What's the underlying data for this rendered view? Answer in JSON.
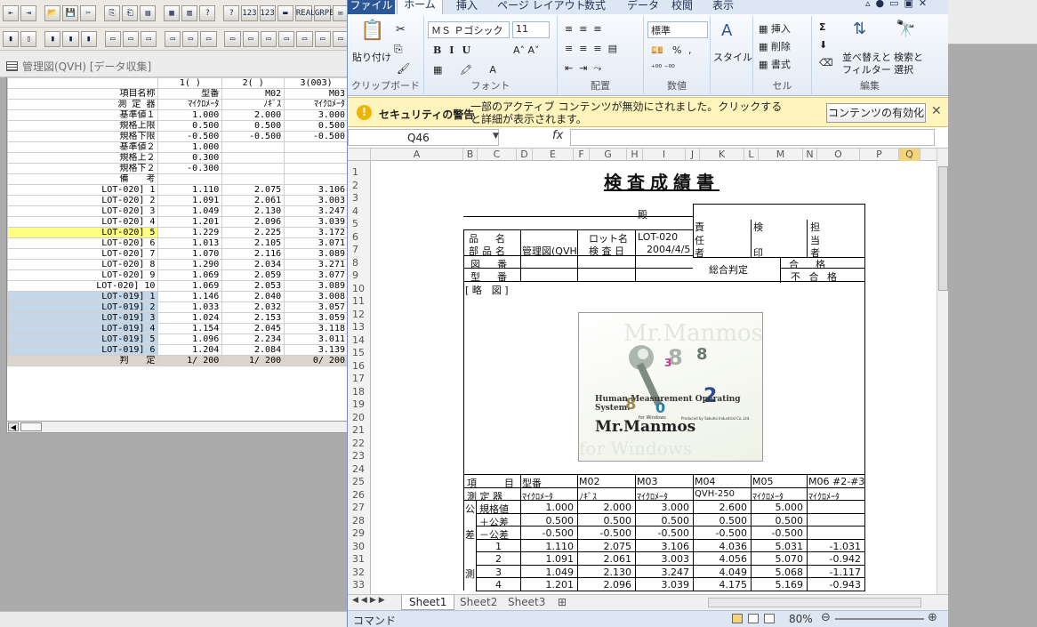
{
  "left_app": {
    "toolbar1": [
      "⇤",
      "⇥",
      "📂",
      "💾",
      "✂",
      "⎘",
      "⎗",
      "▤",
      "▦",
      "▥",
      "?",
      "?",
      "123",
      "123",
      "▬",
      "REAL",
      "GRPE",
      "✉"
    ],
    "toolbar2": [
      "▮",
      "▯",
      "▮",
      "▮",
      "▮",
      "▭",
      "▭",
      "▭",
      "▭",
      "▭",
      "▭",
      "▭",
      "▭",
      "▭",
      "▭",
      "▭",
      "▭",
      "▭"
    ],
    "window_title": "管理図(QVH) [データ収集]",
    "columns": [
      "1(   )",
      "2(   )",
      "3(003)"
    ],
    "rows": [
      {
        "label": "項目名称",
        "v": [
          "型番",
          "M02",
          "M03"
        ]
      },
      {
        "label": "測 定 器",
        "v": [
          "ﾏｲｸﾛﾒｰﾀ",
          "ﾉｷﾞｽ",
          "ﾏｲｸﾛﾒｰﾀ"
        ]
      },
      {
        "label": "基準値１",
        "v": [
          "1.000",
          "2.000",
          "3.000"
        ]
      },
      {
        "label": "規格上限",
        "v": [
          "0.500",
          "0.500",
          "0.500"
        ]
      },
      {
        "label": "規格下限",
        "v": [
          "-0.500",
          "-0.500",
          "-0.500"
        ]
      },
      {
        "label": "基準値２",
        "v": [
          "1.000",
          "",
          ""
        ]
      },
      {
        "label": "規格上２",
        "v": [
          "0.300",
          "",
          ""
        ]
      },
      {
        "label": "規格下２",
        "v": [
          "-0.300",
          "",
          ""
        ]
      },
      {
        "label": "備　　考",
        "v": [
          "",
          "",
          ""
        ]
      }
    ],
    "data_rows": [
      {
        "label": "LOT-020]     1",
        "v": [
          "1.110",
          "2.075",
          "3.106"
        ],
        "cls": "lot20"
      },
      {
        "label": "LOT-020]     2",
        "v": [
          "1.091",
          "2.061",
          "3.003"
        ],
        "cls": "lot20"
      },
      {
        "label": "LOT-020]     3",
        "v": [
          "1.049",
          "2.130",
          "3.247"
        ],
        "cls": "lot20"
      },
      {
        "label": "LOT-020]     4",
        "v": [
          "1.201",
          "2.096",
          "3.039"
        ],
        "cls": "lot20"
      },
      {
        "label": "LOT-020]     5",
        "v": [
          "1.229",
          "2.225",
          "3.172"
        ],
        "cls": "lot20 hl"
      },
      {
        "label": "LOT-020]     6",
        "v": [
          "1.013",
          "2.105",
          "3.071"
        ],
        "cls": "lot20"
      },
      {
        "label": "LOT-020]     7",
        "v": [
          "1.070",
          "2.116",
          "3.089"
        ],
        "cls": "lot20"
      },
      {
        "label": "LOT-020]     8",
        "v": [
          "1.290",
          "2.034",
          "3.271"
        ],
        "cls": "lot20"
      },
      {
        "label": "LOT-020]     9",
        "v": [
          "1.069",
          "2.059",
          "3.077"
        ],
        "cls": "lot20"
      },
      {
        "label": "LOT-020]    10",
        "v": [
          "1.069",
          "2.053",
          "3.089"
        ],
        "cls": "lot20"
      },
      {
        "label": "LOT-019]     1",
        "v": [
          "1.146",
          "2.040",
          "3.008"
        ],
        "cls": "lot19"
      },
      {
        "label": "LOT-019]     2",
        "v": [
          "1.033",
          "2.032",
          "3.057"
        ],
        "cls": "lot19"
      },
      {
        "label": "LOT-019]     3",
        "v": [
          "1.024",
          "2.153",
          "3.059"
        ],
        "cls": "lot19"
      },
      {
        "label": "LOT-019]     4",
        "v": [
          "1.154",
          "2.045",
          "3.118"
        ],
        "cls": "lot19"
      },
      {
        "label": "LOT-019]     5",
        "v": [
          "1.096",
          "2.234",
          "3.011"
        ],
        "cls": "lot19"
      },
      {
        "label": "LOT-019]     6",
        "v": [
          "1.204",
          "2.084",
          "3.139"
        ],
        "cls": "lot19"
      }
    ],
    "judge_row": {
      "label": "判　　定",
      "v": [
        "1/ 200",
        "1/ 200",
        "0/ 200"
      ]
    }
  },
  "excel": {
    "tabs": {
      "file": "ファイル",
      "home": "ホーム",
      "insert": "挿入",
      "layout": "ページ レイアウト",
      "formula": "数式",
      "data": "データ",
      "review": "校閲",
      "view": "表示"
    },
    "ribbon": {
      "paste": "貼り付け",
      "clipboard": "クリップボード",
      "font_name": "ＭＳ Ｐゴシック",
      "font_size": "11",
      "font": "フォント",
      "alignment": "配置",
      "number_format": "標準",
      "number": "数値",
      "style": "スタイル",
      "insert": "挿入",
      "delete": "削除",
      "format": "書式",
      "cells": "セル",
      "sort": "並べ替えと",
      "filter": "フィルター",
      "find": "検索と",
      "select": "選択",
      "edit": "編集",
      "percent": "%",
      "comma": ","
    },
    "security": {
      "title": "セキュリティの警告",
      "message": "一部のアクティブ コンテンツが無効にされました。クリックすると詳細が表示されます。",
      "button": "コンテンツの有効化"
    },
    "name_box": "Q46",
    "fx": "fx",
    "columns": [
      "A",
      "B",
      "C",
      "D",
      "E",
      "F",
      "G",
      "H",
      "I",
      "J",
      "K",
      "L",
      "M",
      "N",
      "O",
      "P",
      "Q"
    ],
    "rows": [
      "1",
      "2",
      "3",
      "4",
      "5",
      "6",
      "7",
      "8",
      "9",
      "10",
      "11",
      "12",
      "13",
      "14",
      "15",
      "16",
      "17",
      "18",
      "19",
      "20",
      "21",
      "22",
      "23",
      "24",
      "25",
      "26",
      "27",
      "28",
      "29",
      "30",
      "31",
      "32",
      "33"
    ],
    "doc": {
      "title": "検査成績書",
      "dono": "殿",
      "seki": "責",
      "nin": "任",
      "sha": "者",
      "ken": "検",
      "in": "印",
      "tan": "担",
      "tou": "当",
      "sha2": "者",
      "hinmei_l": "品　名",
      "buhin_l": "部品名",
      "buhin_v": "管理図(QVH",
      "lot_l": "ロット名",
      "lot_v": "LOT-020",
      "date_l": "検 査 日",
      "date_v": "2004/4/5",
      "zuban_l": "図　番",
      "kataban_l": "型　番",
      "sogo": "総合判定",
      "gokaku": "合　格",
      "fugokaku": "不 合 格",
      "ryakuzu": "[ 略　図 ]",
      "logo_watermark": "Mr.Manmos",
      "logo_tagline": "Human Measurement Operating System.",
      "logo_name": "Mr.Manmos",
      "logo_for": "for Windows",
      "logo_pub": "Produced by Sokuho Industrial Co.,Ltd.",
      "logo_wm2": "for Windows",
      "t_koumoku": "項　　目",
      "t_sokuteiki": "測 定 器",
      "t_kou": "公",
      "t_sa": "差",
      "t_sokutei": "測",
      "t_kikakuchi": "規格値",
      "t_plus": "＋公差",
      "t_minus": "－公差",
      "headers": [
        "型番",
        "M02",
        "M03",
        "M04",
        "M05",
        "M06 #2-#3"
      ],
      "instruments": [
        "ﾏｲｸﾛﾒｰﾀ",
        "ﾉｷﾞｽ",
        "ﾏｲｸﾛﾒｰﾀ",
        "QVH-250",
        "ﾏｲｸﾛﾒｰﾀ",
        "ﾏｲｸﾛﾒｰﾀ"
      ],
      "kikaku": [
        "1.000",
        "2.000",
        "3.000",
        "2.600",
        "5.000",
        ""
      ],
      "plus": [
        "0.500",
        "0.500",
        "0.500",
        "0.500",
        "0.500",
        ""
      ],
      "minus": [
        "-0.500",
        "-0.500",
        "-0.500",
        "-0.500",
        "-0.500",
        ""
      ],
      "meas": [
        {
          "n": "1",
          "v": [
            "1.110",
            "2.075",
            "3.106",
            "4.036",
            "5.031",
            "-1.031"
          ]
        },
        {
          "n": "2",
          "v": [
            "1.091",
            "2.061",
            "3.003",
            "4.056",
            "5.070",
            "-0.942"
          ]
        },
        {
          "n": "3",
          "v": [
            "1.049",
            "2.130",
            "3.247",
            "4.049",
            "5.068",
            "-1.117"
          ]
        },
        {
          "n": "4",
          "v": [
            "1.201",
            "2.096",
            "3.039",
            "4.175",
            "5.169",
            "-0.943"
          ]
        }
      ]
    },
    "sheet_tabs": [
      "Sheet1",
      "Sheet2",
      "Sheet3"
    ],
    "status_mode": "コマンド",
    "zoom": "80%"
  }
}
